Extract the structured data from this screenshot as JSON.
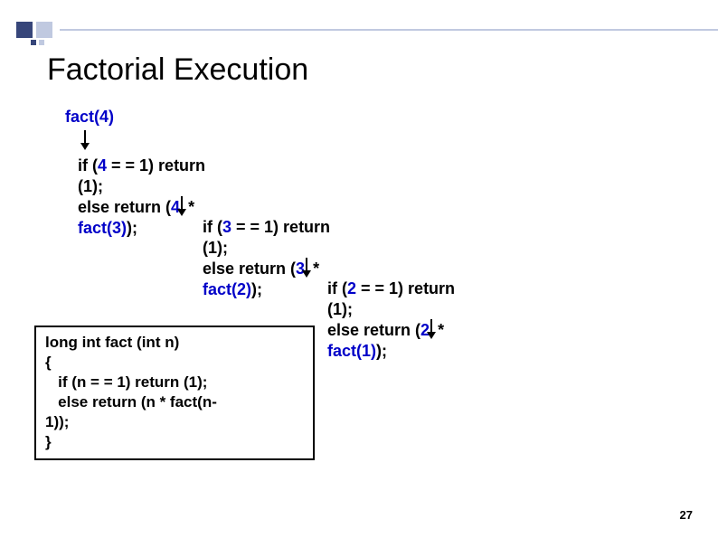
{
  "title": "Factorial Execution",
  "call0": "fact(4)",
  "step1": {
    "line1_a": "if   (",
    "line1_b": "4",
    "line1_c": " = = 1) return",
    "line2": "(1);",
    "line3_a": "else return  (",
    "line3_b": "4",
    "line3_c": " *",
    "line4_a": "fact(3)",
    "line4_b": ");"
  },
  "step2": {
    "line1_a": "if   (",
    "line1_b": "3",
    "line1_c": " = = 1) return",
    "line2": "(1);",
    "line3_a": "else return  (",
    "line3_b": "3",
    "line3_c": " *",
    "line4_a": "fact(2)",
    "line4_b": ");"
  },
  "step3": {
    "line1_a": "if   (",
    "line1_b": "2",
    "line1_c": " = = 1) return",
    "line2": "(1);",
    "line3_a": "else return  (",
    "line3_b": "2",
    "line3_c": " *",
    "line4_a": "fact(1)",
    "line4_b": ");"
  },
  "code": {
    "l1": "long  int  fact (int n)",
    "l2": "{",
    "l3": "   if   (n = = 1) return (1);",
    "l4": "   else return  (n * fact(n-",
    "l5": "1));",
    "l6": "}"
  },
  "page": "27"
}
